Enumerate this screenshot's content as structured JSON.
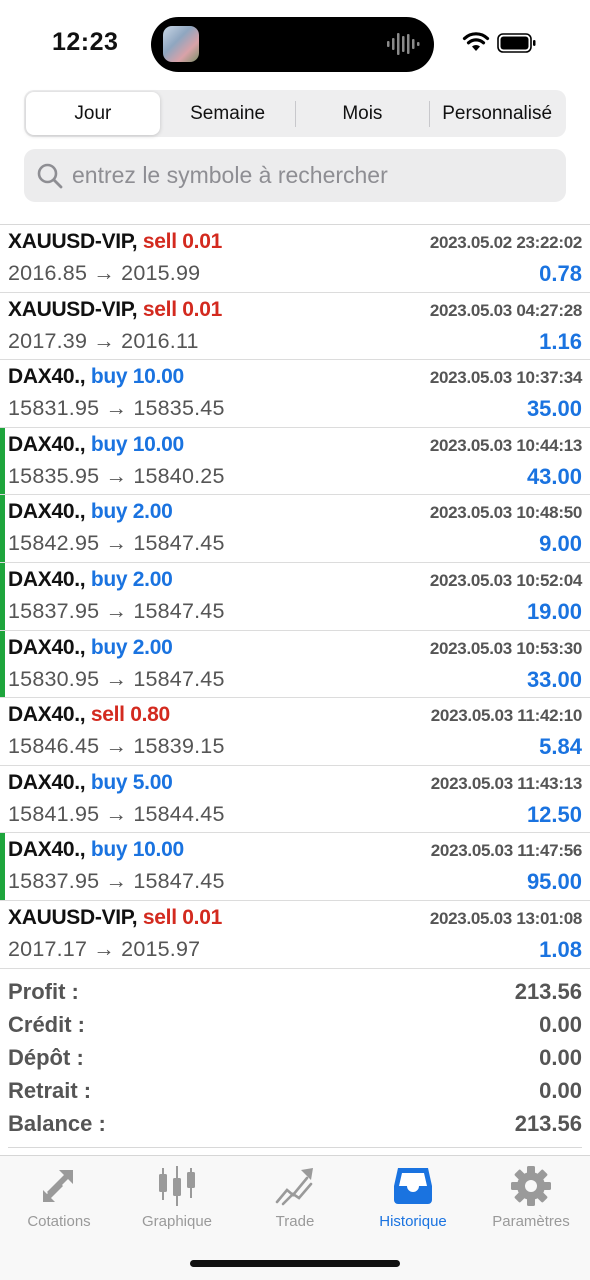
{
  "status": {
    "time": "12:23"
  },
  "segments": [
    {
      "label": "Jour",
      "active": true
    },
    {
      "label": "Semaine",
      "active": false
    },
    {
      "label": "Mois",
      "active": false
    },
    {
      "label": "Personnalisé",
      "active": false
    }
  ],
  "search": {
    "placeholder": "entrez le symbole à rechercher",
    "value": ""
  },
  "trades": [
    {
      "symbol": "XAUUSD-VIP,",
      "direction": "sell",
      "lots": "0.01",
      "date": "2023.05.02 23:22:02",
      "prices": "2016.85 → 2015.99",
      "profit": "0.78",
      "marker": false
    },
    {
      "symbol": "XAUUSD-VIP,",
      "direction": "sell",
      "lots": "0.01",
      "date": "2023.05.03 04:27:28",
      "prices": "2017.39 → 2016.11",
      "profit": "1.16",
      "marker": false
    },
    {
      "symbol": "DAX40.,",
      "direction": "buy",
      "lots": "10.00",
      "date": "2023.05.03 10:37:34",
      "prices": "15831.95 → 15835.45",
      "profit": "35.00",
      "marker": false
    },
    {
      "symbol": "DAX40.,",
      "direction": "buy",
      "lots": "10.00",
      "date": "2023.05.03 10:44:13",
      "prices": "15835.95 → 15840.25",
      "profit": "43.00",
      "marker": true
    },
    {
      "symbol": "DAX40.,",
      "direction": "buy",
      "lots": "2.00",
      "date": "2023.05.03 10:48:50",
      "prices": "15842.95 → 15847.45",
      "profit": "9.00",
      "marker": true
    },
    {
      "symbol": "DAX40.,",
      "direction": "buy",
      "lots": "2.00",
      "date": "2023.05.03 10:52:04",
      "prices": "15837.95 → 15847.45",
      "profit": "19.00",
      "marker": true
    },
    {
      "symbol": "DAX40.,",
      "direction": "buy",
      "lots": "2.00",
      "date": "2023.05.03 10:53:30",
      "prices": "15830.95 → 15847.45",
      "profit": "33.00",
      "marker": true
    },
    {
      "symbol": "DAX40.,",
      "direction": "sell",
      "lots": "0.80",
      "date": "2023.05.03 11:42:10",
      "prices": "15846.45 → 15839.15",
      "profit": "5.84",
      "marker": false
    },
    {
      "symbol": "DAX40.,",
      "direction": "buy",
      "lots": "5.00",
      "date": "2023.05.03 11:43:13",
      "prices": "15841.95 → 15844.45",
      "profit": "12.50",
      "marker": false
    },
    {
      "symbol": "DAX40.,",
      "direction": "buy",
      "lots": "10.00",
      "date": "2023.05.03 11:47:56",
      "prices": "15837.95 → 15847.45",
      "profit": "95.00",
      "marker": true
    },
    {
      "symbol": "XAUUSD-VIP,",
      "direction": "sell",
      "lots": "0.01",
      "date": "2023.05.03 13:01:08",
      "prices": "2017.17 → 2015.97",
      "profit": "1.08",
      "marker": false
    }
  ],
  "summary": [
    {
      "label": "Profit :",
      "value": "213.56"
    },
    {
      "label": "Crédit :",
      "value": "0.00"
    },
    {
      "label": "Dépôt :",
      "value": "0.00"
    },
    {
      "label": "Retrait :",
      "value": "0.00"
    },
    {
      "label": "Balance :",
      "value": "213.56"
    }
  ],
  "tabs": [
    {
      "label": "Cotations",
      "icon": "quotes-arrows-icon",
      "active": false
    },
    {
      "label": "Graphique",
      "icon": "candlestick-chart-icon",
      "active": false
    },
    {
      "label": "Trade",
      "icon": "trade-line-icon",
      "active": false
    },
    {
      "label": "Historique",
      "icon": "history-inbox-icon",
      "active": true
    },
    {
      "label": "Paramètres",
      "icon": "gear-icon",
      "active": false
    }
  ],
  "colors": {
    "accent": "#1a73e0",
    "sell": "#d32a1f",
    "buy": "#1a73e0",
    "marker": "#1ea53c",
    "inactive_tab": "#9a9a9a"
  }
}
